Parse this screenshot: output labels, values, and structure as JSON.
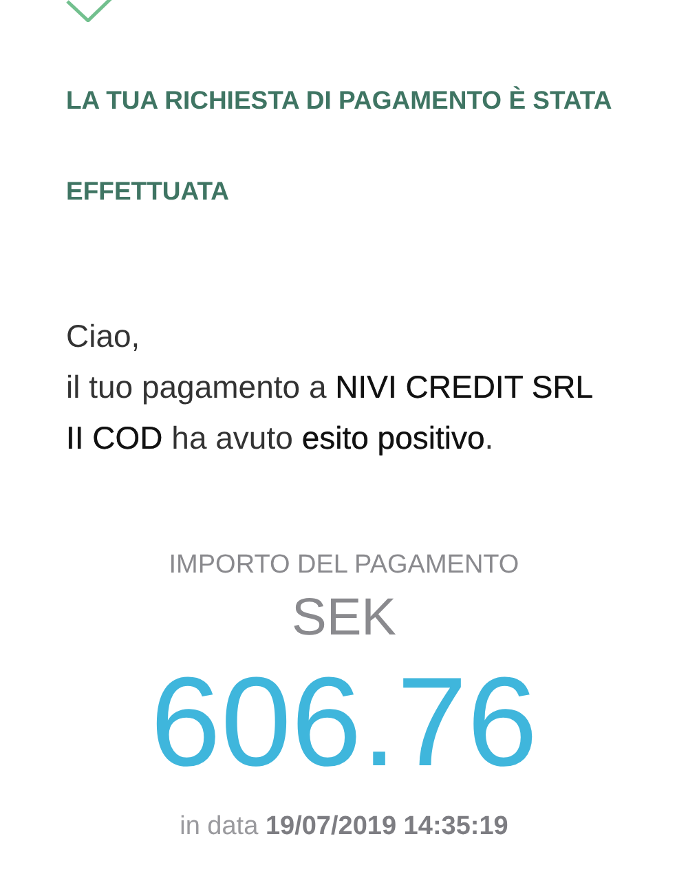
{
  "title": "LA TUA RICHIESTA DI PAGAMENTO È STATA EFFETTUATA",
  "greeting": "Ciao,",
  "message": "il tuo pagamento a **NIVI CREDIT SRL II COD** ha avuto **esito positivo**.",
  "amount": {
    "label": "IMPORTO DEL PAGAMENTO",
    "currency": "SEK",
    "value": "606.76",
    "date": "in data **19/07/2019 14:35:19**"
  }
}
